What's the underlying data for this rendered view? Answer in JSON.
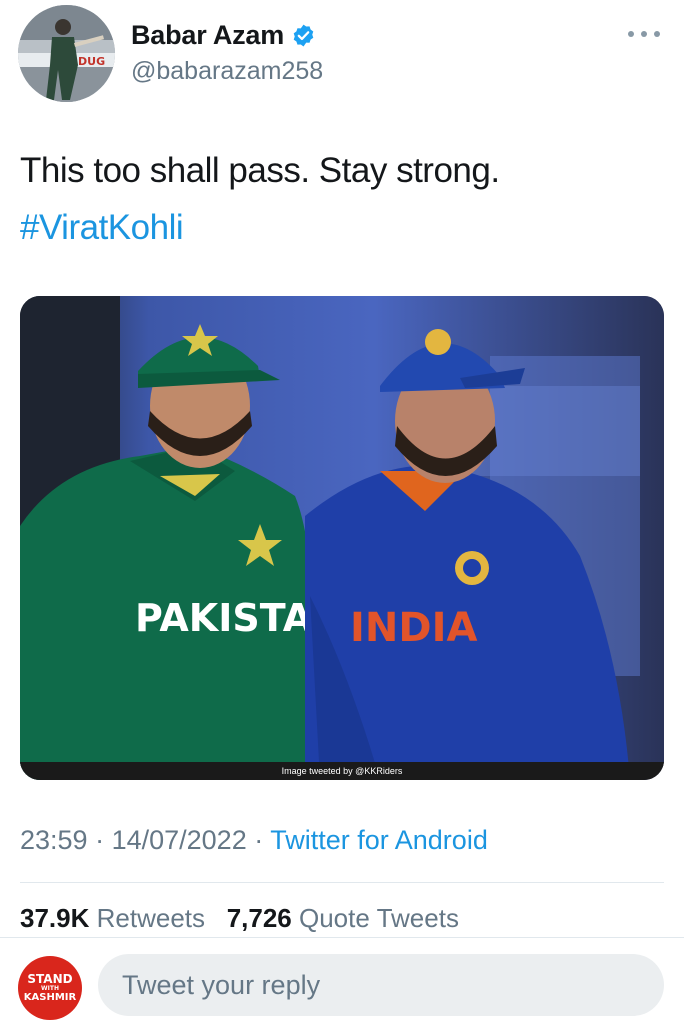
{
  "tweet": {
    "author": {
      "display_name": "Babar Azam",
      "handle": "@babarazam258",
      "verified": true
    },
    "text": "This too shall pass. Stay strong.",
    "hashtag": "#ViratKohli",
    "media": {
      "jersey_left": "PAKISTAN",
      "jersey_right": "INDIA",
      "caption": "Image tweeted by @KKRiders"
    },
    "meta": {
      "time": "23:59",
      "sep1": " · ",
      "date": "14/07/2022",
      "sep2": " · ",
      "source": "Twitter for Android"
    },
    "stats": {
      "retweets_count": "37.9K",
      "retweets_label": "Retweets",
      "quotes_count": "7,726",
      "quotes_label": "Quote Tweets"
    }
  },
  "reply": {
    "avatar_text": [
      "STAND",
      "WITH",
      "KASHMIR"
    ],
    "placeholder": "Tweet your reply"
  },
  "colors": {
    "link": "#1b95e0",
    "secondary_text": "#657786",
    "primary_text": "#14171a",
    "verified": "#1da1f2",
    "pakistan_green": "#0f6b4a",
    "india_blue": "#1f3fa8",
    "reply_avatar_red": "#d9261c"
  },
  "icons": [
    "verified-badge-icon",
    "more-options-icon"
  ]
}
